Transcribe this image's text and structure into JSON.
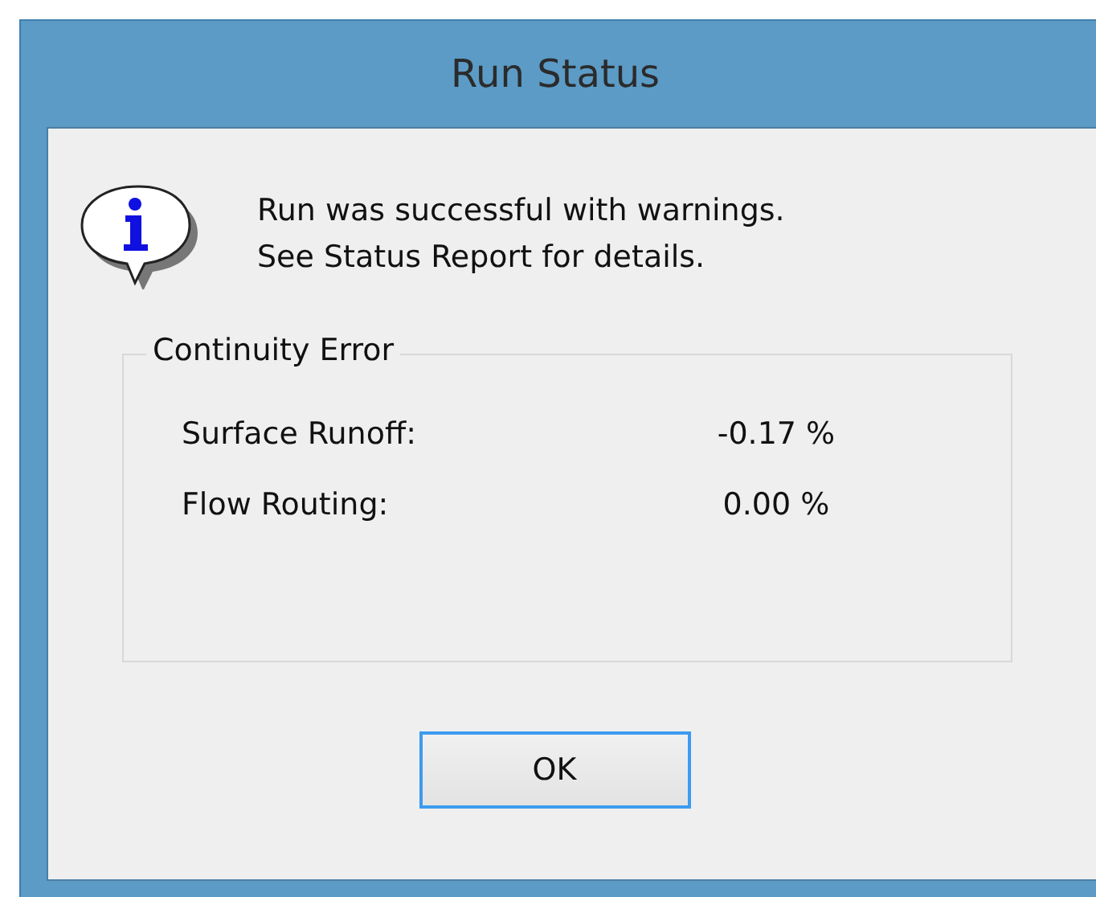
{
  "window": {
    "title": "Run Status"
  },
  "message": {
    "lines": [
      "Run was successful with warnings.",
      "See Status Report for details."
    ]
  },
  "group": {
    "title": "Continuity Error",
    "rows": [
      {
        "label": "Surface Runoff:",
        "value": "-0.17 %"
      },
      {
        "label": "Flow Routing:",
        "value": "0.00 %"
      }
    ]
  },
  "buttons": [
    {
      "label": "OK",
      "focused": true
    }
  ]
}
